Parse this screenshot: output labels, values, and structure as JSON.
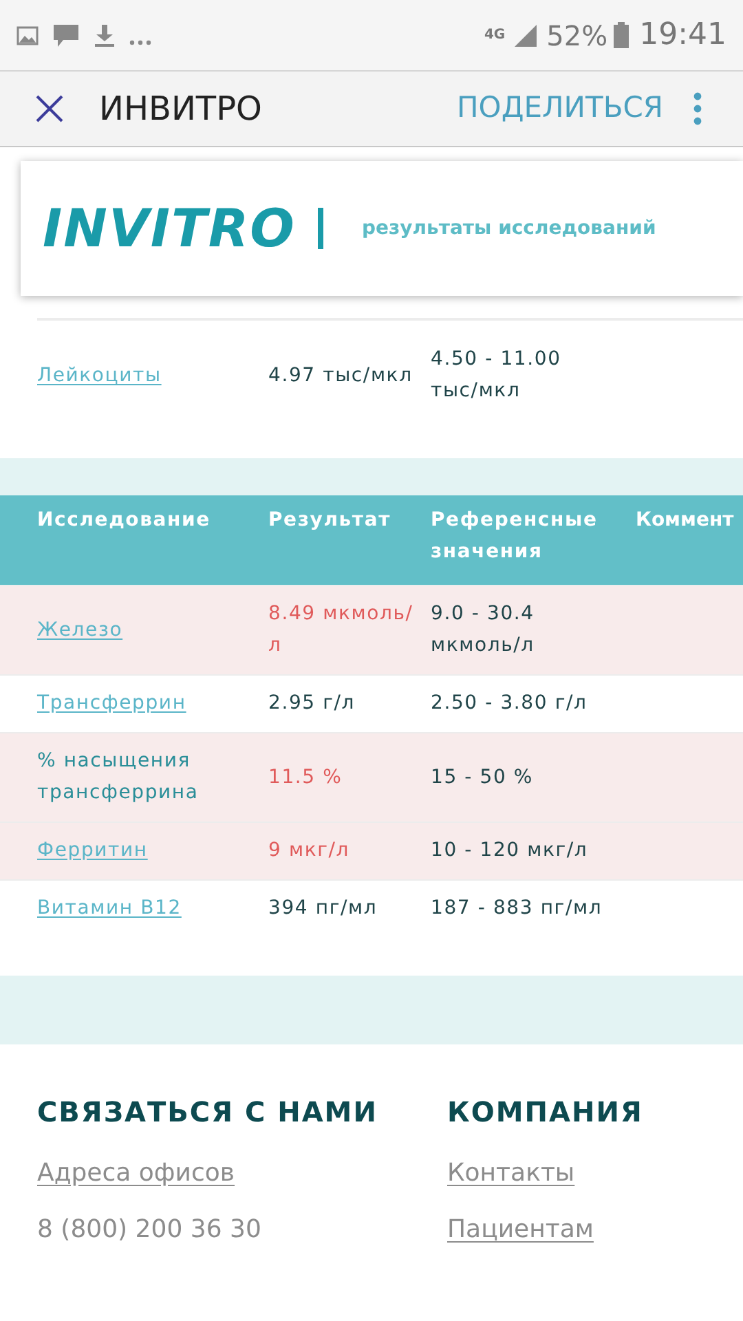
{
  "status_bar": {
    "time": "19:41",
    "battery": "52%",
    "network": "4G"
  },
  "app_bar": {
    "title": "ИНВИТРО",
    "action": "ПОДЕЛИТЬСЯ"
  },
  "banner": {
    "logo": "INVITRO",
    "subtitle": "результаты исследований"
  },
  "top_rows": [
    {
      "name": "Лейкоциты",
      "link": true,
      "abnormal": false,
      "result": "4.97 тыс/мкл",
      "reference": "4.50 - 11.00 тыс/мкл"
    }
  ],
  "table": {
    "columns": [
      "Исследование",
      "Результат",
      "Референсные значения",
      "Коммент"
    ],
    "rows": [
      {
        "name": "Железо",
        "link": true,
        "abnormal": true,
        "result": "8.49 мкмоль/л",
        "reference": "9.0 - 30.4 мкмоль/л"
      },
      {
        "name": "Трансферрин",
        "link": true,
        "abnormal": false,
        "result": "2.95 г/л",
        "reference": "2.50 - 3.80 г/л"
      },
      {
        "name": "% насыщения трансферрина",
        "link": false,
        "abnormal": true,
        "result": "11.5 %",
        "reference": "15 - 50 %"
      },
      {
        "name": "Ферритин",
        "link": true,
        "abnormal": true,
        "result": "9 мкг/л",
        "reference": "10 - 120 мкг/л"
      },
      {
        "name": "Витамин В12",
        "link": true,
        "abnormal": false,
        "result": "394 пг/мл",
        "reference": "187 - 883 пг/мл"
      }
    ]
  },
  "footer": {
    "columns": [
      {
        "heading": "СВЯЗАТЬСЯ С НАМИ",
        "items": [
          {
            "text": "Адреса офисов",
            "link": true
          },
          {
            "text": "8 (800) 200 36 30",
            "link": false
          }
        ]
      },
      {
        "heading": "КОМПАНИЯ",
        "items": [
          {
            "text": "Контакты",
            "link": true
          },
          {
            "text": "Пациентам",
            "link": true
          }
        ]
      }
    ]
  }
}
